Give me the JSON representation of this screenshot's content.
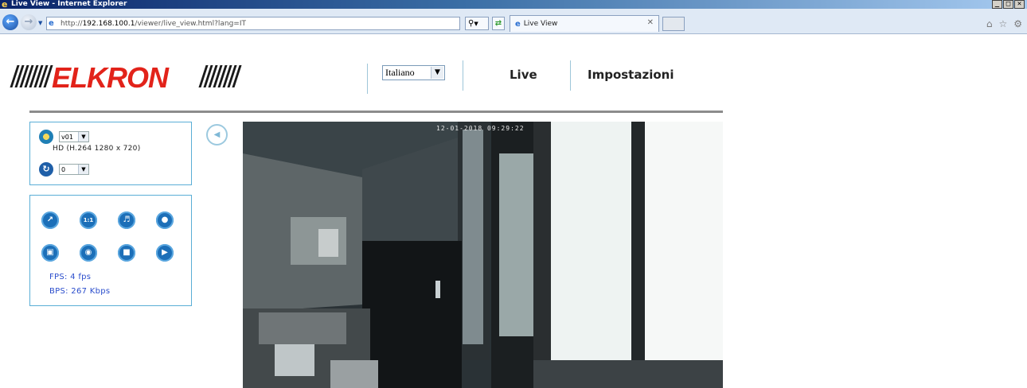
{
  "window": {
    "title": "Live View - Internet Explorer",
    "buttons": [
      "_",
      "□",
      "✕"
    ]
  },
  "browser": {
    "url_prefix": "http://",
    "url_host": "192.168.100.1",
    "url_path": "/viewer/live_view.html?lang=IT",
    "tab_title": "Live View",
    "search_icon": "search-icon",
    "tools_icons": [
      "home-icon",
      "favorites-icon",
      "settings-icon"
    ]
  },
  "header": {
    "logo_text": "ELKRON",
    "language": {
      "selected": "Italiano"
    },
    "nav": {
      "live": "Live",
      "settings": "Impostazioni"
    }
  },
  "stream_panel": {
    "stream_select": "v01",
    "stream_info": "HD (H.264 1280 x 720)",
    "rotation_select": "0"
  },
  "control_panel": {
    "controls": [
      "fullscreen-icon",
      "actual-size-icon",
      "audio-icon",
      "talk-icon",
      "snapshot-icon",
      "record-icon",
      "folder-icon",
      "playback-icon"
    ],
    "fps_label": "FPS: 4 fps",
    "bps_label": "BPS: 267 Kbps"
  },
  "video": {
    "timestamp": "12-01-2018 09:29:22"
  },
  "colors": {
    "accent": "#5aaed6",
    "brand": "#e2231a",
    "stats": "#2a4dcc"
  }
}
